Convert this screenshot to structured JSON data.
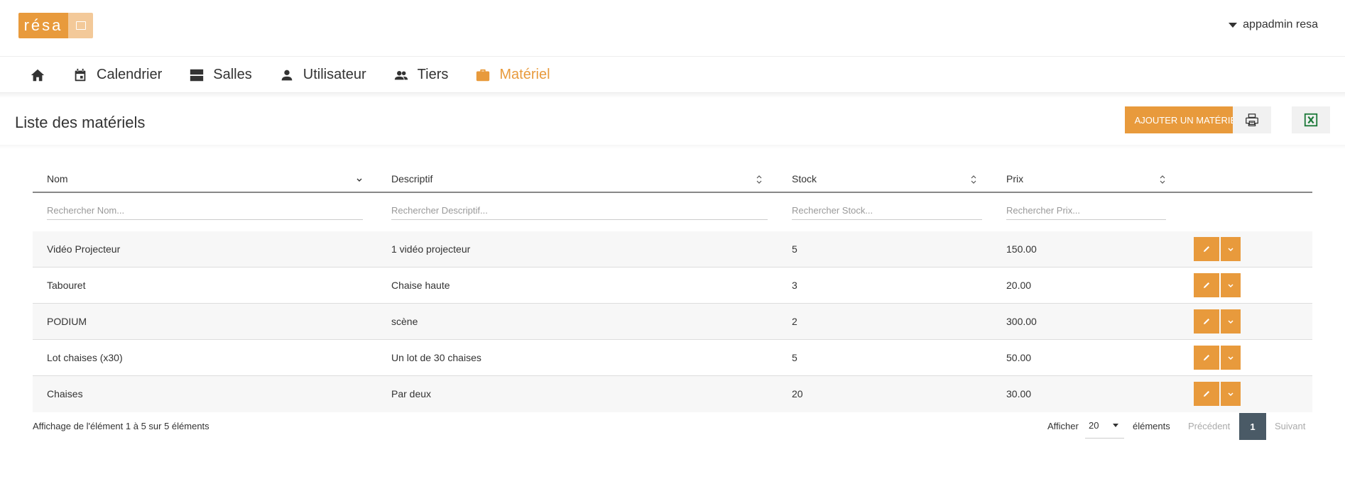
{
  "header": {
    "logo_text": "résa",
    "user_name": "appadmin resa"
  },
  "nav": {
    "items": [
      {
        "label": "",
        "icon": "home-icon"
      },
      {
        "label": "Calendrier",
        "icon": "calendar-icon"
      },
      {
        "label": "Salles",
        "icon": "rooms-icon"
      },
      {
        "label": "Utilisateur",
        "icon": "user-icon"
      },
      {
        "label": "Tiers",
        "icon": "group-icon"
      },
      {
        "label": "Matériel",
        "icon": "briefcase-icon",
        "active": true
      }
    ]
  },
  "page": {
    "title": "Liste des matériels",
    "add_button": "AJOUTER UN MATÉRIEL",
    "accent_color": "#e89a3c"
  },
  "table": {
    "columns": [
      "Nom",
      "Descriptif",
      "Stock",
      "Prix"
    ],
    "search_placeholders": [
      "Rechercher Nom...",
      "Rechercher Descriptif...",
      "Rechercher Stock...",
      "Rechercher Prix..."
    ],
    "rows": [
      [
        "Vidéo Projecteur",
        "1 vidéo projecteur",
        "5",
        "150.00"
      ],
      [
        "Tabouret",
        "Chaise haute",
        "3",
        "20.00"
      ],
      [
        "PODIUM",
        "scène",
        "2",
        "300.00"
      ],
      [
        "Lot chaises (x30)",
        "Un lot de 30 chaises",
        "5",
        "50.00"
      ],
      [
        "Chaises",
        "Par deux",
        "20",
        "30.00"
      ]
    ]
  },
  "footer": {
    "info": "Affichage de l'élément 1 à 5 sur 5 éléments",
    "show_label": "Afficher",
    "page_size": "20",
    "show_suffix": "éléments",
    "prev": "Précédent",
    "current_page": "1",
    "next": "Suivant"
  }
}
